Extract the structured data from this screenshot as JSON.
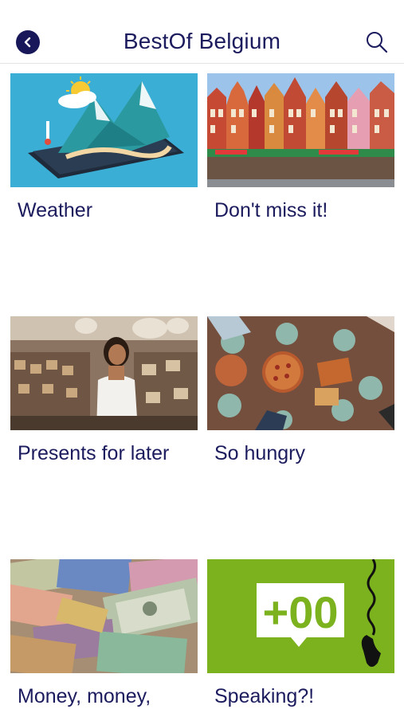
{
  "header": {
    "title": "BestOf Belgium",
    "back_icon": "chevron-left-icon",
    "search_icon": "search-icon"
  },
  "tiles": [
    {
      "label": "Weather",
      "image": "weather-tablet-mountains-illustration"
    },
    {
      "label": "Don't miss it!",
      "image": "bruges-market-square-photo"
    },
    {
      "label": "Presents for later",
      "image": "gift-shop-woman-photo"
    },
    {
      "label": "So hungry",
      "image": "shared-pizza-table-photo"
    },
    {
      "label": "Money, money,",
      "image": "world-banknotes-photo"
    },
    {
      "label": "Speaking?!",
      "image": "phone-country-code-plus00-icon"
    }
  ],
  "colors": {
    "brand": "#1b1b5e",
    "green_tile": "#7bb21e"
  }
}
